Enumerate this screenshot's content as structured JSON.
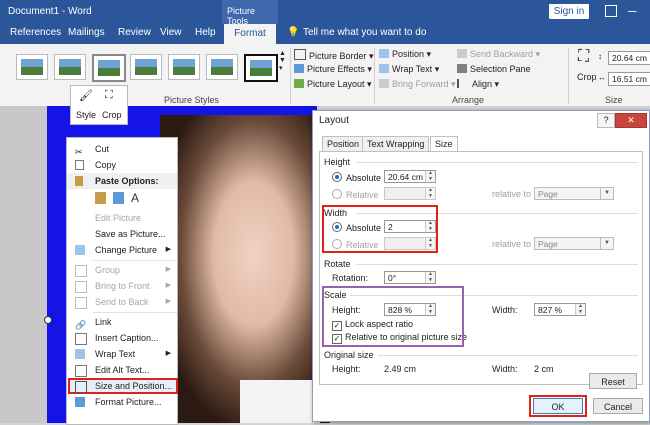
{
  "window": {
    "title": "Document1  -  Word",
    "context_tab_group": "Picture Tools",
    "signin": "Sign in"
  },
  "tabs": [
    "References",
    "Mailings",
    "Review",
    "View",
    "Help",
    "Format"
  ],
  "tell_me": "Tell me what you want to do",
  "ribbon": {
    "picture_styles_label": "Picture Styles",
    "picture_border": "Picture Border",
    "picture_effects": "Picture Effects",
    "picture_layout": "Picture Layout",
    "position": "Position",
    "wrap_text": "Wrap Text",
    "bring_forward": "Bring Forward",
    "send_backward": "Send Backward",
    "selection_pane": "Selection Pane",
    "align": "Align",
    "arrange_label": "Arrange",
    "crop": "Crop",
    "height_value": "20.64 cm",
    "width_value": "16.51 cm",
    "size_label": "Size"
  },
  "mini_toolbar": {
    "style": "Style",
    "crop": "Crop"
  },
  "context_menu": {
    "cut": "Cut",
    "copy": "Copy",
    "paste_options": "Paste Options:",
    "edit_picture": "Edit Picture",
    "save_as_picture": "Save as Picture...",
    "change_picture": "Change Picture",
    "group": "Group",
    "bring_to_front": "Bring to Front",
    "send_to_back": "Send to Back",
    "link": "Link",
    "insert_caption": "Insert Caption...",
    "wrap_text": "Wrap Text",
    "edit_alt_text": "Edit Alt Text...",
    "size_and_position": "Size and Position...",
    "format_picture": "Format Picture..."
  },
  "dialog": {
    "title": "Layout",
    "help": "?",
    "close": "✕",
    "tabs": [
      "Position",
      "Text Wrapping",
      "Size"
    ],
    "height_section": "Height",
    "absolute": "Absolute",
    "relative": "Relative",
    "height_absolute_value": "20.64 cm",
    "relative_to": "relative to",
    "page": "Page",
    "width_section": "Width",
    "width_absolute_value": "2",
    "rotate_section": "Rotate",
    "rotation": "Rotation:",
    "rotation_value": "0°",
    "scale_section": "Scale",
    "height": "Height:",
    "scale_height_value": "828 %",
    "width": "Width:",
    "scale_width_value": "827 %",
    "lock_aspect": "Lock aspect ratio",
    "relative_original": "Relative to original picture size",
    "original_size_section": "Original size",
    "orig_height_label": "Height:",
    "orig_height_value": "2.49 cm",
    "orig_width_label": "Width:",
    "orig_width_value": "2 cm",
    "reset": "Reset",
    "ok": "OK",
    "cancel": "Cancel"
  },
  "colors": {
    "accent": "#2b579a",
    "highlight": "#e0201a",
    "scale_box": "#9b5fb1",
    "picture_bg": "#1414e8"
  }
}
